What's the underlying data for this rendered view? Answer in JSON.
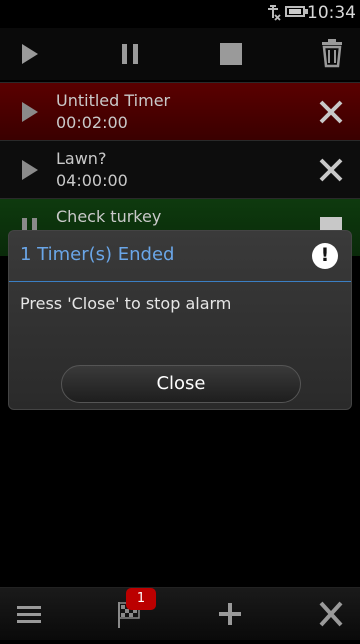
{
  "status": {
    "time": "10:34"
  },
  "toolbar": {
    "icons": [
      "play-icon",
      "pause-icon",
      "stop-icon",
      "trash-icon"
    ]
  },
  "timers": [
    {
      "name": "Untitled Timer",
      "time": "00:02:00",
      "state": "ended"
    },
    {
      "name": "Lawn?",
      "time": "04:00:00",
      "state": "idle"
    },
    {
      "name": "Check turkey",
      "time": "",
      "state": "running"
    }
  ],
  "dialog": {
    "title": "1 Timer(s) Ended",
    "message": "Press 'Close' to stop alarm",
    "close_label": "Close"
  },
  "bottombar": {
    "badge_count": "1",
    "icons": [
      "menu-icon",
      "flag-icon",
      "add-icon",
      "exit-icon"
    ]
  },
  "colors": {
    "ended_row": "#4a0000",
    "running_row": "#0e3a0e",
    "dialog_title": "#6aa6e8",
    "badge": "#bb0000"
  }
}
